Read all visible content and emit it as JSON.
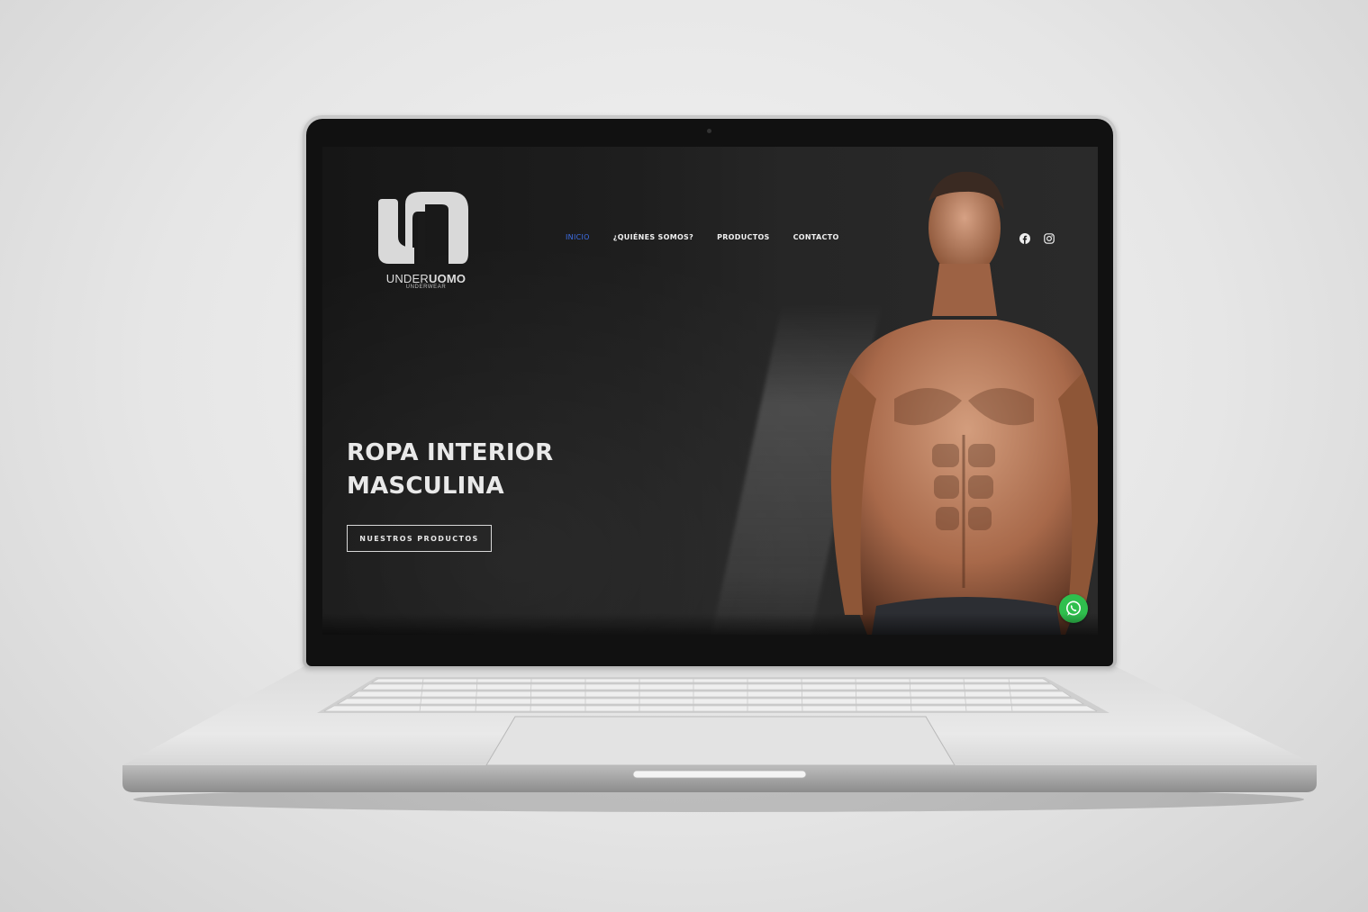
{
  "site": {
    "logo": {
      "brand_light": "UNDER",
      "brand_bold": "UOMO",
      "subtitle": "UNDERWEAR"
    },
    "nav": {
      "items": [
        {
          "label": "INICIO",
          "active": true
        },
        {
          "label": "¿QUIÉNES SOMOS?",
          "active": false
        },
        {
          "label": "PRODUCTOS",
          "active": false
        },
        {
          "label": "CONTACTO",
          "active": false
        }
      ],
      "active_color": "#3e6fe8"
    },
    "social": {
      "icons": [
        "facebook-icon",
        "instagram-icon"
      ]
    },
    "hero": {
      "title_line1": "ROPA INTERIOR",
      "title_line2": "MASCULINA",
      "cta_label": "NUESTROS PRODUCTOS"
    },
    "floating": {
      "icon": "whatsapp-icon",
      "color": "#2fbf4d"
    }
  },
  "device": {
    "type": "laptop-mockup",
    "frame_color": "#c9c9c9"
  }
}
